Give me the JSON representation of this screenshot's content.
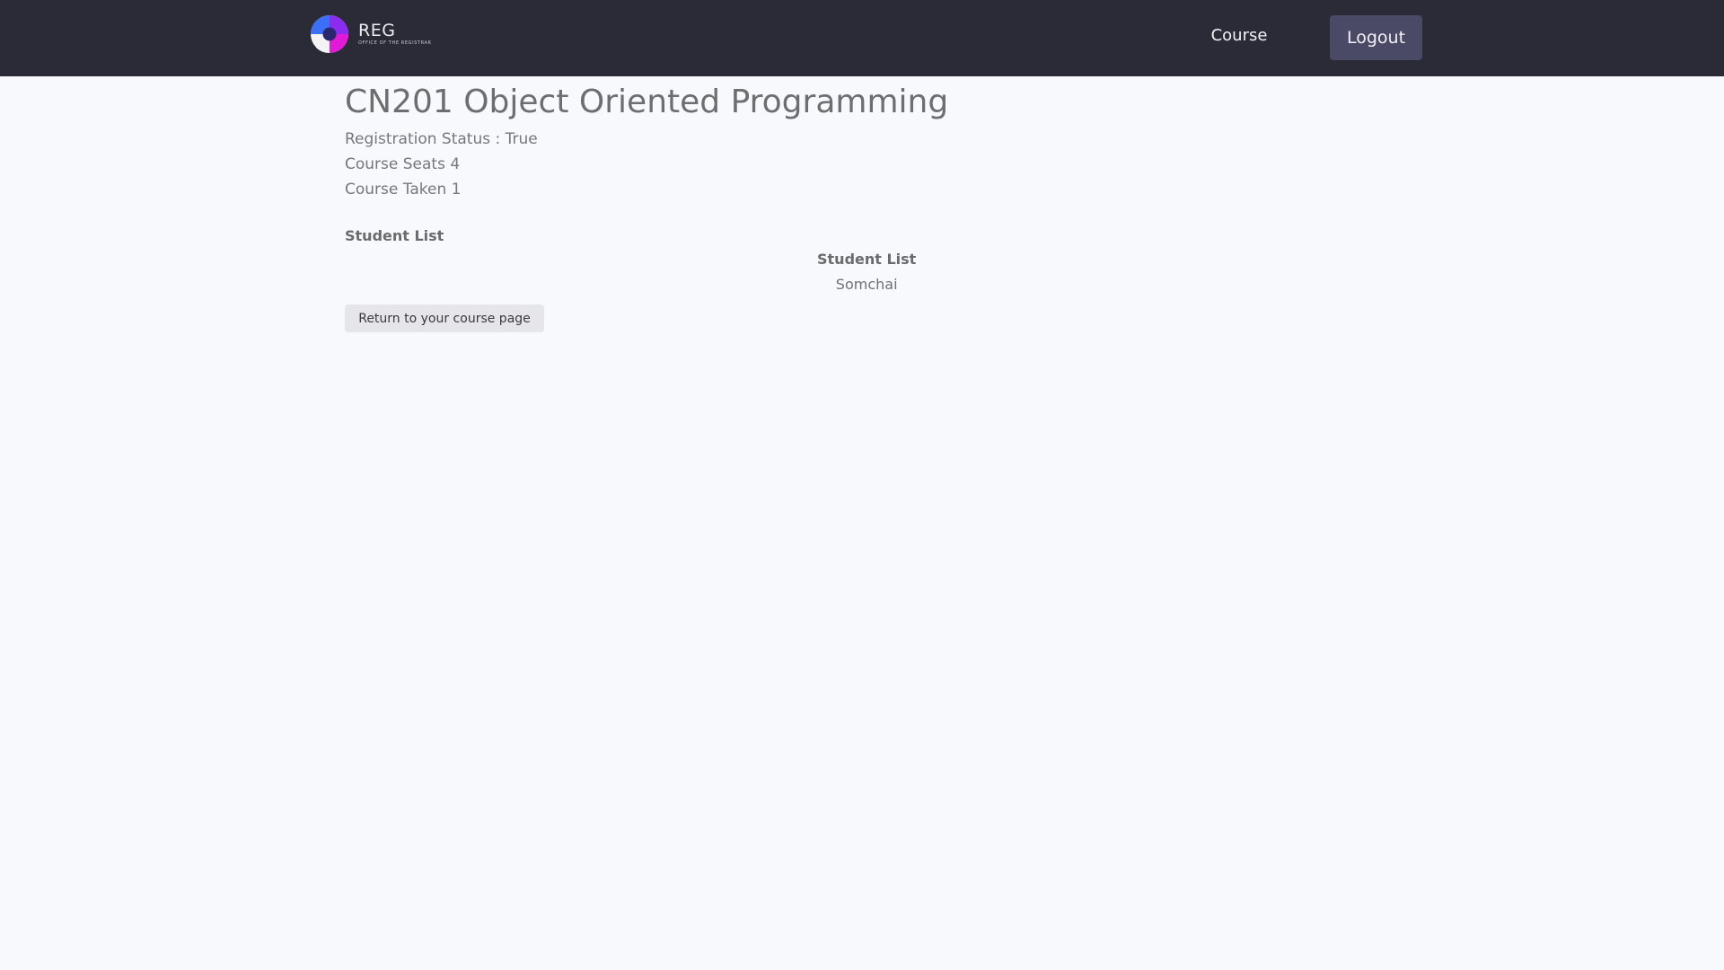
{
  "navbar": {
    "brand": {
      "name": "REG",
      "subtitle": "OFFICE OF THE REGISTRAR",
      "logo_icon": "reg-logo-icon",
      "logo_colors": [
        "#3b6ff5",
        "#8b2cf0",
        "#e11ad9",
        "#f4f4f4",
        "#2a2670"
      ]
    },
    "links": [
      {
        "label": "Course"
      }
    ],
    "logout_label": "Logout",
    "background": "#2b2b38",
    "logout_color": "#4a4a66"
  },
  "course": {
    "title": "CN201 Object Oriented Programming",
    "registration_status": "Registration Status : True",
    "seats": "Course Seats 4",
    "taken": "Course Taken 1"
  },
  "student_list": {
    "heading": "Student List",
    "table_header": "Student List",
    "students": [
      "Somchai"
    ]
  },
  "actions": {
    "return_label": "Return to your course page"
  }
}
